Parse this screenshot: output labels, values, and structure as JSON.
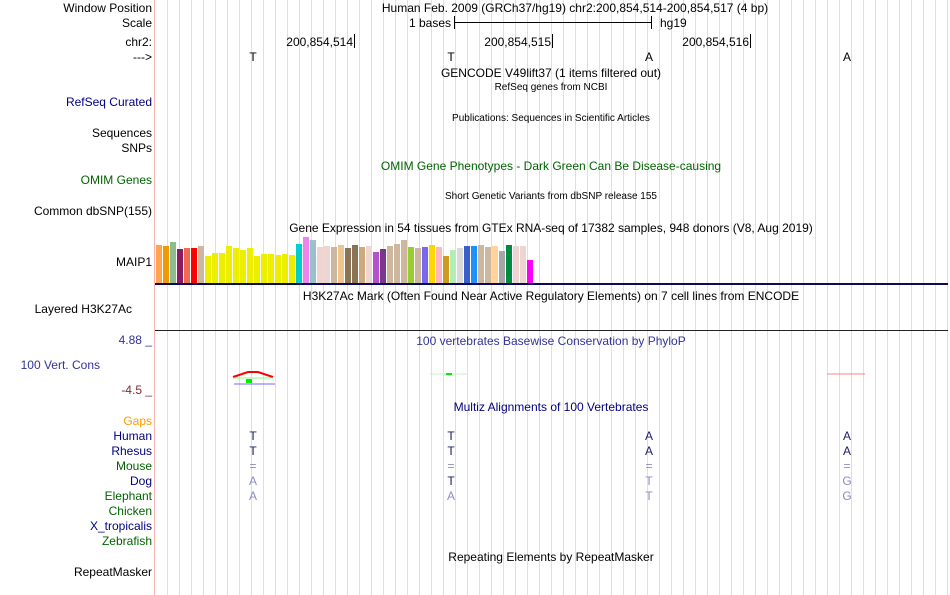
{
  "header": {
    "window_position_label": "Window Position",
    "scale_label": "Scale",
    "chrom_label": "chr2:",
    "strand_label": "--->",
    "assembly_position": "Human Feb. 2009 (GRCh37/hg19)   chr2:200,854,514-200,854,517 (4 bp)",
    "scale_text": "1 bases",
    "scale_db": "hg19",
    "ruler_ticks": [
      "200,854,514",
      "200,854,515",
      "200,854,516"
    ],
    "bases": [
      "T",
      "T",
      "A",
      "A"
    ]
  },
  "tracks": {
    "gencode_title": "GENCODE V49lift37 (1 items filtered out)",
    "refseq_title": "RefSeq genes from NCBI",
    "refseq_label": "RefSeq Curated",
    "publications_title": "Publications: Sequences in Scientific Articles",
    "sequences_label": "Sequences",
    "snps_label": "SNPs",
    "omim_title": "OMIM Gene Phenotypes - Dark Green Can Be Disease-causing",
    "omim_label": "OMIM Genes",
    "dbsnp_title": "Short Genetic Variants from dbSNP release 155",
    "dbsnp_label": "Common dbSNP(155)",
    "gtex_title": "Gene Expression in 54 tissues from GTEx RNA-seq of 17382 samples, 948 donors (V8, Aug 2019)",
    "gtex_label": "MAIP1",
    "h3k27ac_title": "H3K27Ac Mark (Often Found Near Active Regulatory Elements) on 7 cell lines from ENCODE",
    "h3k27ac_label": "Layered H3K27Ac",
    "phylop_title": "100 vertebrates Basewise Conservation by PhyloP",
    "phylop_label": "100 Vert. Cons",
    "phylop_max": "4.88 _",
    "phylop_min": "-4.5 _",
    "multiz_title": "Multiz Alignments of 100 Vertebrates",
    "gaps_label": "Gaps",
    "repeatmasker_title": "Repeating Elements by RepeatMasker",
    "repeatmasker_label": "RepeatMasker"
  },
  "alignment": [
    {
      "species": "Human",
      "color": "#000080",
      "bases": [
        "T",
        "T",
        "A",
        "A"
      ],
      "base_color": "#1a1a6e"
    },
    {
      "species": "Rhesus",
      "color": "#000080",
      "bases": [
        "T",
        "T",
        "A",
        "A"
      ],
      "base_color": "#1a1a6e"
    },
    {
      "species": "Mouse",
      "color": "#006400",
      "bases": [
        "=",
        "=",
        "=",
        "="
      ],
      "base_color": "#8c8cc0"
    },
    {
      "species": "Dog",
      "color": "#000080",
      "bases": [
        "A",
        "T",
        "T",
        "G"
      ],
      "base_colors": [
        "#8c8cc0",
        "#1a1a6e",
        "#8c8cc0",
        "#8c8cc0"
      ]
    },
    {
      "species": "Elephant",
      "color": "#006400",
      "bases": [
        "A",
        "A",
        "T",
        "G"
      ],
      "base_color": "#8c8cc0"
    },
    {
      "species": "Chicken",
      "color": "#006400",
      "bases": []
    },
    {
      "species": "X_tropicalis",
      "color": "#000080",
      "bases": []
    },
    {
      "species": "Zebrafish",
      "color": "#006400",
      "bases": []
    }
  ],
  "colors": {
    "label_blue": "#000080",
    "omim_green": "#006400",
    "gaps_orange": "#ff9900",
    "phylop_title": "#333399",
    "phylop_max": "#333399",
    "phylop_min": "#7f2b2b"
  },
  "gtex": {
    "levels": [
      0.82,
      0.8,
      0.89,
      0.74,
      0.76,
      0.76,
      0.8,
      0.58,
      0.65,
      0.65,
      0.8,
      0.76,
      0.72,
      0.76,
      0.58,
      0.63,
      0.63,
      0.61,
      0.63,
      0.61,
      0.85,
      1.0,
      0.93,
      0.79,
      0.8,
      0.78,
      0.82,
      0.76,
      0.82,
      0.79,
      0.8,
      0.67,
      0.74,
      0.8,
      0.85,
      0.93,
      0.78,
      0.76,
      0.78,
      0.82,
      0.79,
      0.58,
      0.72,
      0.76,
      0.8,
      0.8,
      0.82,
      0.79,
      0.8,
      0.69,
      0.82,
      0.8,
      0.8,
      0.5
    ],
    "colors": [
      "#FFA54F",
      "#EE9A00",
      "#8FBC8F",
      "#8B1C62",
      "#EE6A50",
      "#FF0000",
      "#CDB79E",
      "#EEEE00",
      "#EEEE00",
      "#EEEE00",
      "#EEEE00",
      "#EEEE00",
      "#EEEE00",
      "#EEEE00",
      "#EEEE00",
      "#EEEE00",
      "#EEEE00",
      "#EEEE00",
      "#EEEE00",
      "#EEEE00",
      "#00CDCD",
      "#EE82EE",
      "#9AC0CD",
      "#EED5D2",
      "#EED5D2",
      "#CDB79E",
      "#EEC591",
      "#8B7355",
      "#8B7355",
      "#CDAA7D",
      "#EED5D2",
      "#B452CD",
      "#7A378B",
      "#CDB79E",
      "#CDB79E",
      "#CDB79E",
      "#9ACD32",
      "#CDB79E",
      "#7A67EE",
      "#FFD700",
      "#FFB6C1",
      "#CD9B1D",
      "#B4EEB4",
      "#D9D9D9",
      "#3A5FCD",
      "#1E90FF",
      "#CDB79E",
      "#CDB79E",
      "#FFD39B",
      "#A6A6A6",
      "#008B45",
      "#EED5D2",
      "#EED5D2",
      "#FF00FF"
    ]
  }
}
